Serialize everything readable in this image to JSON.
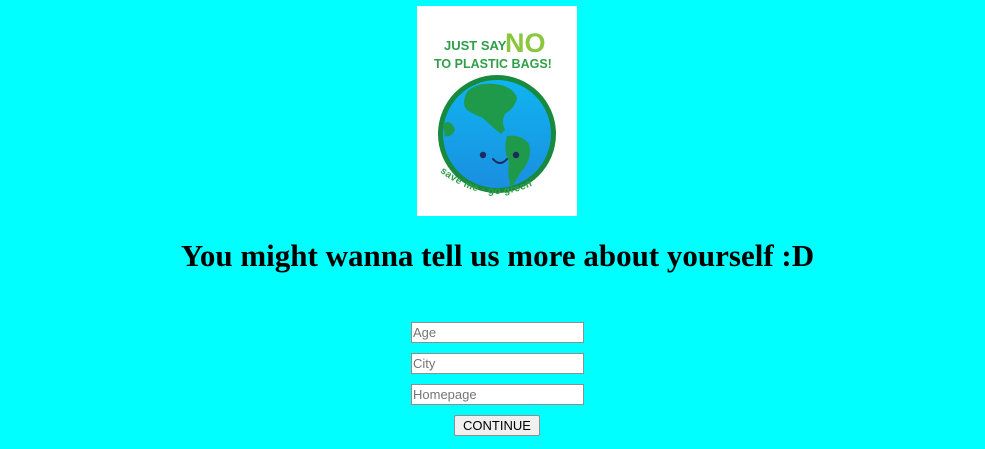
{
  "poster": {
    "line1_prefix": "JUST SAY",
    "line1_emphasis": "NO",
    "line2": "TO PLASTIC BAGS!",
    "caption": "save me · go green",
    "colors": {
      "title_green": "#2e9e48",
      "no_green": "#8cc63f",
      "ocean": "#1ba3e8",
      "land": "#1f9a4a",
      "rim": "#178a3e"
    }
  },
  "heading": "You might wanna tell us more about yourself :D",
  "form": {
    "age": {
      "value": "",
      "placeholder": "Age"
    },
    "city": {
      "value": "",
      "placeholder": "City"
    },
    "homepage": {
      "value": "",
      "placeholder": "Homepage"
    },
    "continue_label": "CONTINUE"
  }
}
